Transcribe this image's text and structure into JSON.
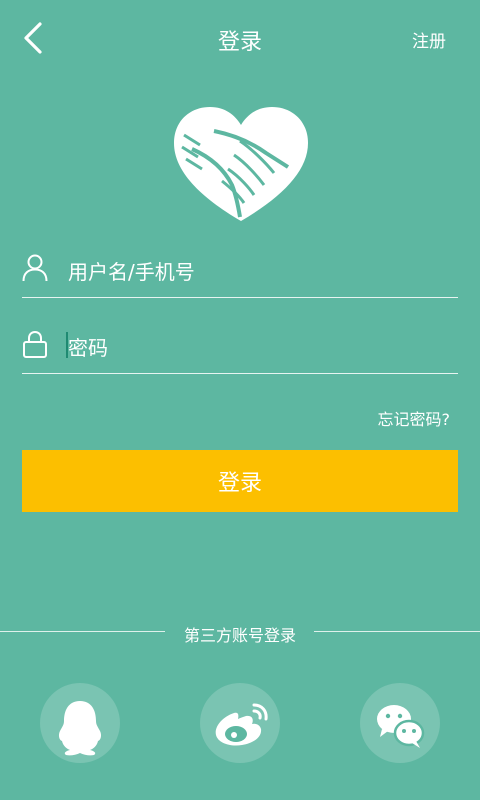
{
  "header": {
    "title": "登录",
    "register": "注册"
  },
  "form": {
    "username": {
      "placeholder": "用户名/手机号",
      "icon": "user-icon"
    },
    "password": {
      "placeholder": "密码",
      "icon": "lock-icon"
    },
    "forgot": "忘记密码?",
    "login": "登录"
  },
  "third_party": {
    "label": "第三方账号登录",
    "options": [
      "qq-icon",
      "weibo-icon",
      "wechat-icon"
    ]
  },
  "colors": {
    "background": "#5db7a1",
    "button": "#fcbf00",
    "text": "#ffffff"
  }
}
